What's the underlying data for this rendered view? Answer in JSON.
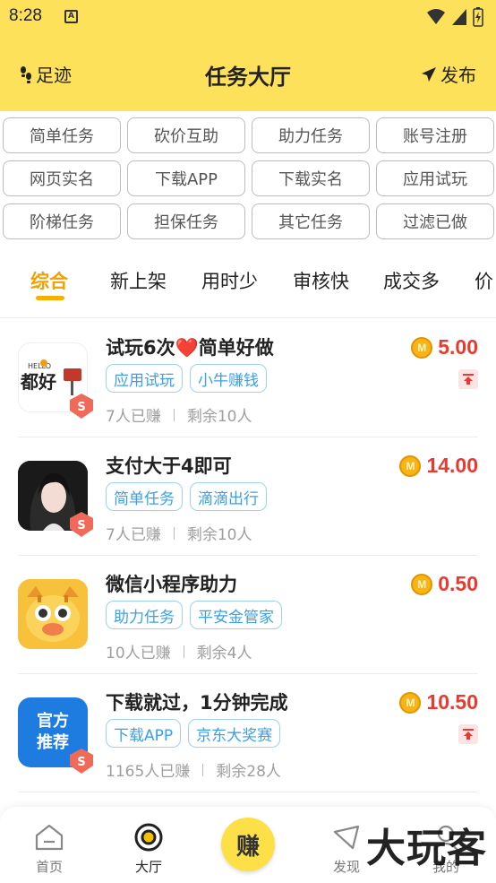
{
  "status_bar": {
    "time": "8:28",
    "notification_letter": "A"
  },
  "header": {
    "left_label": "足迹",
    "title": "任务大厅",
    "right_label": "发布"
  },
  "categories": [
    "简单任务",
    "砍价互助",
    "助力任务",
    "账号注册",
    "网页实名",
    "下载APP",
    "下载实名",
    "应用试玩",
    "阶梯任务",
    "担保任务",
    "其它任务",
    "过滤已做"
  ],
  "sort_tabs": [
    "综合",
    "新上架",
    "用时少",
    "审核快",
    "成交多",
    "价"
  ],
  "active_sort_tab": "综合",
  "tasks": [
    {
      "title": "试玩6次❤️简单好做",
      "tags": [
        "应用试玩",
        "小牛赚钱"
      ],
      "earned": "7人已赚",
      "remaining": "剩余10人",
      "price": "5.00",
      "coin_letter": "M",
      "pinned": true,
      "icon_text": "都好",
      "icon_subtext": "HELLO"
    },
    {
      "title": "支付大于4即可",
      "tags": [
        "简单任务",
        "滴滴出行"
      ],
      "earned": "7人已赚",
      "remaining": "剩余10人",
      "price": "14.00",
      "coin_letter": "M",
      "pinned": false
    },
    {
      "title": "微信小程序助力",
      "tags": [
        "助力任务",
        "平安金管家"
      ],
      "earned": "10人已赚",
      "remaining": "剩余4人",
      "price": "0.50",
      "coin_letter": "M",
      "pinned": false
    },
    {
      "title": "下载就过，1分钟完成",
      "tags": [
        "下载APP",
        "京东大奖赛"
      ],
      "earned": "1165人已赚",
      "remaining": "剩余28人",
      "price": "10.50",
      "coin_letter": "M",
      "pinned": true,
      "icon_text": "官方推荐"
    }
  ],
  "badge_letter": "S",
  "bottom_nav": {
    "home": "首页",
    "hall": "大厅",
    "earn": "赚",
    "discover": "发现",
    "mine": "我的"
  },
  "watermark": "大玩客",
  "colors": {
    "header_bg": "#fde15b",
    "accent": "#f2a100",
    "price": "#e93a32",
    "tag": "#3ba0e6"
  }
}
